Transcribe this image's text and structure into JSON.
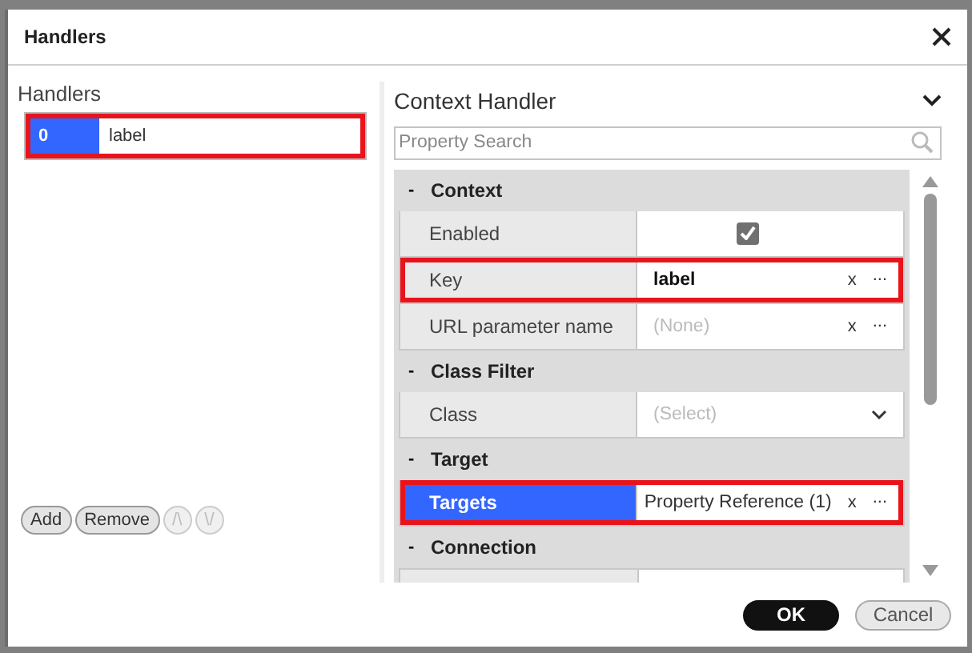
{
  "window": {
    "title": "Handlers"
  },
  "handlers": {
    "title": "Handlers",
    "items": [
      {
        "index": "0",
        "label": "label",
        "selected": true,
        "highlighted": true
      }
    ],
    "buttons": [
      {
        "label": "Add",
        "disabled": false
      },
      {
        "label": "Remove",
        "disabled": false
      },
      {
        "label": "/\\",
        "disabled": true
      },
      {
        "label": "\\/",
        "disabled": true
      }
    ]
  },
  "properties": {
    "title": "Context Handler",
    "search": {
      "placeholder": "Property Search"
    },
    "sections": [
      {
        "toggle": "-",
        "title": "Context",
        "rows": [
          {
            "name": "Enabled",
            "kind": "checkbox",
            "checked": true,
            "selected": false,
            "highlighted": false
          },
          {
            "name": "Key",
            "kind": "text",
            "value": "label",
            "clear": "x",
            "more": "...",
            "selected": false,
            "highlighted": true
          },
          {
            "name": "URL parameter name",
            "kind": "text",
            "placeholder": "(None)",
            "clear": "x",
            "more": "...",
            "selected": false,
            "highlighted": false
          }
        ]
      },
      {
        "toggle": "-",
        "title": "Class Filter",
        "rows": [
          {
            "name": "Class",
            "kind": "select",
            "placeholder": "(Select)",
            "selected": false,
            "highlighted": false
          }
        ]
      },
      {
        "toggle": "-",
        "title": "Target",
        "rows": [
          {
            "name": "Targets",
            "kind": "text",
            "value": "Property Reference (1)",
            "clear": "x",
            "more": "...",
            "selected": true,
            "highlighted": true
          }
        ]
      },
      {
        "toggle": "-",
        "title": "Connection"
      }
    ]
  },
  "footer": {
    "buttons": [
      {
        "label": "OK",
        "kind": "primary"
      },
      {
        "label": "Cancel",
        "kind": "secondary"
      }
    ]
  }
}
